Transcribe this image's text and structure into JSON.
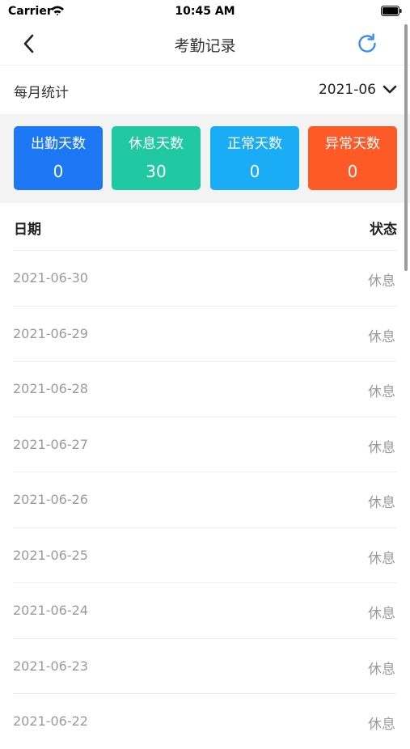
{
  "status_bar": {
    "carrier": "Carrier",
    "time": "10:45 AM"
  },
  "nav": {
    "title": "考勤记录"
  },
  "month": {
    "label": "每月统计",
    "value": "2021-06"
  },
  "stats": [
    {
      "label": "出勤天数",
      "value": "0",
      "color": "#1c78f4"
    },
    {
      "label": "休息天数",
      "value": "30",
      "color": "#20c9a2"
    },
    {
      "label": "正常天数",
      "value": "0",
      "color": "#1aadf5"
    },
    {
      "label": "异常天数",
      "value": "0",
      "color": "#fe5a28"
    }
  ],
  "table": {
    "date_header": "日期",
    "status_header": "状态",
    "rows": [
      {
        "date": "2021-06-30",
        "status": "休息"
      },
      {
        "date": "2021-06-29",
        "status": "休息"
      },
      {
        "date": "2021-06-28",
        "status": "休息"
      },
      {
        "date": "2021-06-27",
        "status": "休息"
      },
      {
        "date": "2021-06-26",
        "status": "休息"
      },
      {
        "date": "2021-06-25",
        "status": "休息"
      },
      {
        "date": "2021-06-24",
        "status": "休息"
      },
      {
        "date": "2021-06-23",
        "status": "休息"
      },
      {
        "date": "2021-06-22",
        "status": "休息"
      }
    ]
  },
  "icons": {
    "back": "chevron-left-icon",
    "refresh": "refresh-icon",
    "dropdown": "chevron-down-icon",
    "wifi": "wifi-icon",
    "battery": "battery-icon"
  },
  "accent_color": "#3a8ef0"
}
